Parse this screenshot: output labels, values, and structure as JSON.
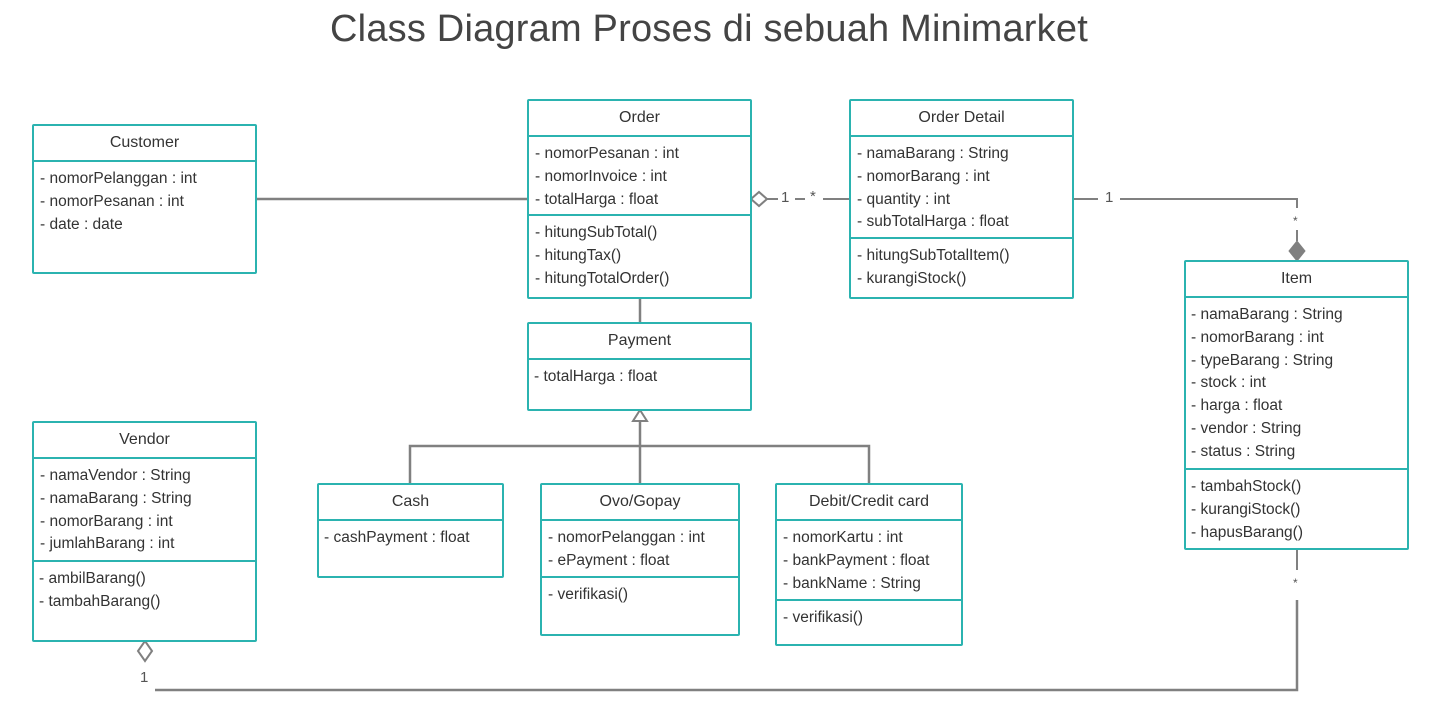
{
  "title": "Class Diagram Proses di sebuah Minimarket",
  "classes": {
    "customer": {
      "name": "Customer",
      "attributes": [
        "-  nomorPelanggan : int",
        "-  nomorPesanan : int",
        "-  date : date"
      ]
    },
    "order": {
      "name": "Order",
      "attributes": [
        "-  nomorPesanan : int",
        "-  nomorInvoice : int",
        "-  totalHarga : float"
      ],
      "methods": [
        "-  hitungSubTotal()",
        "-  hitungTax()",
        "-  hitungTotalOrder()"
      ]
    },
    "order_detail": {
      "name": "Order Detail",
      "attributes": [
        "-  namaBarang : String",
        "-  nomorBarang : int",
        "-  quantity : int",
        "-  subTotalHarga  : float"
      ],
      "methods": [
        "-  hitungSubTotalItem()",
        "-  kurangiStock()"
      ]
    },
    "item": {
      "name": "Item",
      "attributes": [
        "- namaBarang : String",
        "- nomorBarang : int",
        "- typeBarang : String",
        "- stock : int",
        "- harga : float",
        "- vendor : String",
        "- status : String"
      ],
      "methods": [
        "- tambahStock()",
        "- kurangiStock()",
        "- hapusBarang()"
      ]
    },
    "payment": {
      "name": "Payment",
      "attributes": [
        "- totalHarga : float"
      ]
    },
    "vendor": {
      "name": "Vendor",
      "attributes": [
        "-  namaVendor  : String",
        "-  namaBarang : String",
        "-  nomorBarang : int",
        "-  jumlahBarang : int"
      ],
      "methods": [
        "- ambilBarang()",
        "- tambahBarang()"
      ]
    },
    "cash": {
      "name": "Cash",
      "attributes": [
        "- cashPayment : float"
      ]
    },
    "ovo_gopay": {
      "name": "Ovo/Gopay",
      "attributes": [
        "-  nomorPelanggan : int",
        "-  ePayment : float"
      ],
      "methods": [
        "-  verifikasi()"
      ]
    },
    "debit_credit": {
      "name": "Debit/Credit card",
      "attributes": [
        "-  nomorKartu : int",
        "-  bankPayment : float",
        "-  bankName : String"
      ],
      "methods": [
        "-  verifikasi()"
      ]
    }
  },
  "multiplicities": {
    "order_side": "1",
    "order_detail_side": "*",
    "order_detail_to_item": "1",
    "item_top": "*",
    "item_bottom": "*",
    "vendor_side": "1"
  },
  "colors": {
    "class_border": "#2bb3b0",
    "connector": "#808080",
    "title": "#444444"
  }
}
